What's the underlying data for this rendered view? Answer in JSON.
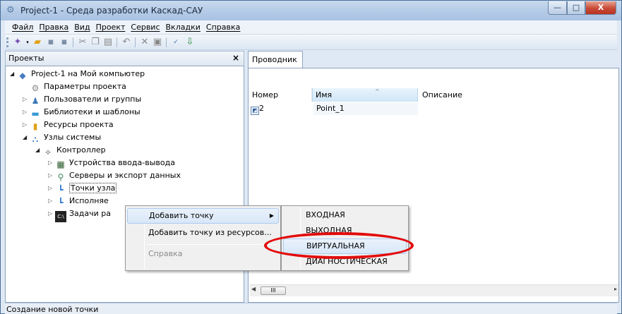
{
  "window": {
    "title": "Project-1 - Среда разработки Каскад-САУ",
    "app_icon": "gear-icon",
    "min_glyph": "—",
    "max_glyph": "□",
    "close_glyph": "X"
  },
  "menu": [
    "Файл",
    "Правка",
    "Вид",
    "Проект",
    "Сервис",
    "Вкладки",
    "Справка"
  ],
  "toolbar": {
    "icons": [
      "add-dropdown-icon",
      "open-folder-icon",
      "save-icon",
      "save-all-icon",
      "cut-icon",
      "copy-icon",
      "paste-icon",
      "undo-icon",
      "delete-icon",
      "properties-icon",
      "spellcheck-icon",
      "download-icon"
    ]
  },
  "projects_panel": {
    "title": "Проекты",
    "close_glyph": "×",
    "tree": [
      {
        "label": "Project-1 на Мой компьютер",
        "icon": "project-icon"
      },
      {
        "label": "Параметры проекта",
        "icon": "settings-icon"
      },
      {
        "label": "Пользователи и группы",
        "icon": "users-icon"
      },
      {
        "label": "Библиотеки и шаблоны",
        "icon": "library-icon"
      },
      {
        "label": "Ресурсы проекта",
        "icon": "resources-icon"
      },
      {
        "label": "Узлы системы",
        "icon": "nodes-icon"
      },
      {
        "label": "Контроллер",
        "icon": "controller-icon"
      },
      {
        "label": "Устройства ввода-вывода",
        "icon": "io-device-icon"
      },
      {
        "label": "Серверы и экспорт данных",
        "icon": "server-icon"
      },
      {
        "label": "Точки узла",
        "icon": "points-icon"
      },
      {
        "label": "Исполняе",
        "icon": "exec-icon"
      },
      {
        "label": "Задачи ра",
        "icon": "tasks-icon"
      }
    ]
  },
  "explorer": {
    "tab": "Проводник",
    "columns": [
      "Номер",
      "Имя",
      "Описание"
    ],
    "sort_glyph": "^",
    "rows": [
      {
        "number": "2",
        "name": "Point_1",
        "description": ""
      }
    ],
    "scroll_left": "◀",
    "scroll_thumb": "III",
    "scroll_right": "▸"
  },
  "context_menu": {
    "items": [
      {
        "label": "Добавить точку",
        "submenu": true,
        "arrow": "▶"
      },
      {
        "label": "Добавить точку из ресурсов...",
        "submenu": false
      },
      {
        "label": "Справка",
        "disabled": true
      }
    ]
  },
  "submenu": {
    "items": [
      "ВХОДНАЯ",
      "ВЫХОДНАЯ",
      "ВИРТУАЛЬНАЯ",
      "ДИАГНОСТИЧЕСКАЯ"
    ]
  },
  "status_bar": {
    "text": "Создание новой точки"
  },
  "colors": {
    "highlight_circle": "#e30b0b",
    "title_gradient": "#b7cde8"
  }
}
